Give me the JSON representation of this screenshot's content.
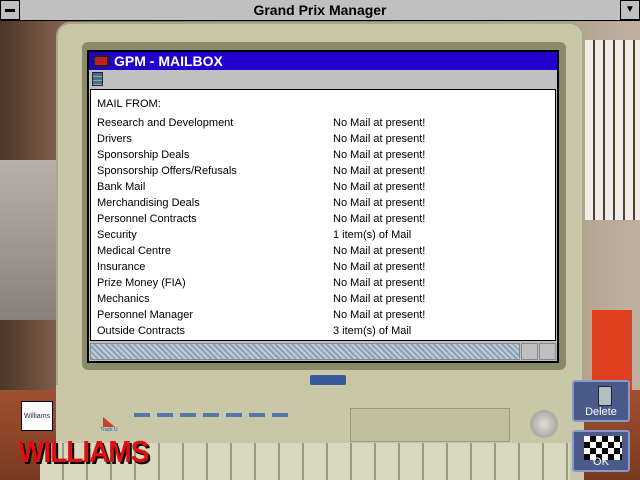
{
  "app_title": "Grand Prix Manager",
  "window": {
    "title": "GPM - MAILBOX",
    "header": "MAIL FROM:"
  },
  "mail": [
    {
      "from": "Research and Development",
      "status": "No Mail at present!"
    },
    {
      "from": "Drivers",
      "status": "No Mail at present!"
    },
    {
      "from": "Sponsorship Deals",
      "status": "No Mail at present!"
    },
    {
      "from": "Sponsorship Offers/Refusals",
      "status": "No Mail at present!"
    },
    {
      "from": "Bank Mail",
      "status": "No Mail at present!"
    },
    {
      "from": "Merchandising Deals",
      "status": "No Mail at present!"
    },
    {
      "from": "Personnel Contracts",
      "status": "No Mail at present!"
    },
    {
      "from": "Security",
      "status": "1 item(s) of Mail"
    },
    {
      "from": "Medical Centre",
      "status": "No Mail at present!"
    },
    {
      "from": "Insurance",
      "status": "No Mail at present!"
    },
    {
      "from": "Prize Money (FIA)",
      "status": "No Mail at present!"
    },
    {
      "from": "Mechanics",
      "status": "No Mail at present!"
    },
    {
      "from": "Personnel Manager",
      "status": "No Mail at present!"
    },
    {
      "from": "Outside Contracts",
      "status": "3 item(s) of Mail"
    }
  ],
  "buttons": {
    "delete": "Delete",
    "ok": "OK"
  },
  "team": {
    "name": "WILLIAMS",
    "logo_text": "Williams",
    "sponsor": "Track U"
  }
}
